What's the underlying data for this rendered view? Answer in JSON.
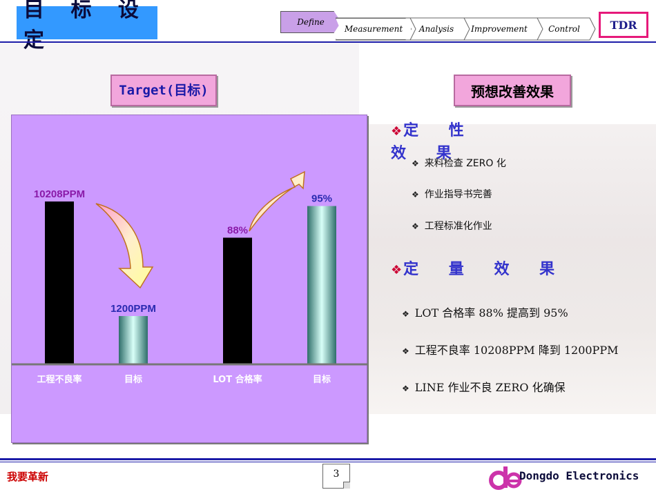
{
  "header": {
    "title": "目 标 设 定",
    "steps": [
      "Define",
      "Measurement",
      "Analysis",
      "Improvement",
      "Control"
    ],
    "tdr_label": "TDR"
  },
  "left_panel": {
    "label": "Target(目标)"
  },
  "right_panel": {
    "label": "预想改善效果",
    "qualitative_heading": "定 性 效 果",
    "qualitative_items": [
      "来料检查 ZERO 化",
      "作业指导书完善",
      "工程标准化作业"
    ],
    "quantitative_heading": "定 量 效 果",
    "quantitative_items": [
      "LOT 合格率 88% 提高到 95%",
      "工程不良率 10208PPM 降到 1200PPM",
      "LINE 作业不良 ZERO 化确保"
    ]
  },
  "chart_data": {
    "type": "bar",
    "categories": [
      "工程不良率",
      "目标",
      "LOT 合格率",
      "目标"
    ],
    "values": [
      10208,
      1200,
      88,
      95
    ],
    "data_labels": [
      "10208PPM",
      "1200PPM",
      "88%",
      "95%"
    ],
    "bar_colors": [
      "#000000",
      "#b8e8e0",
      "#000000",
      "#b8e8e0"
    ],
    "label_colors": [
      "#8a1aa8",
      "#2a2ab0",
      "#8a1aa8",
      "#2a2ab0"
    ],
    "background": "#cc99ff",
    "grid": false
  },
  "footer": {
    "slogan": "我要革新",
    "page": "3",
    "company": "Dongdo Electronics"
  }
}
